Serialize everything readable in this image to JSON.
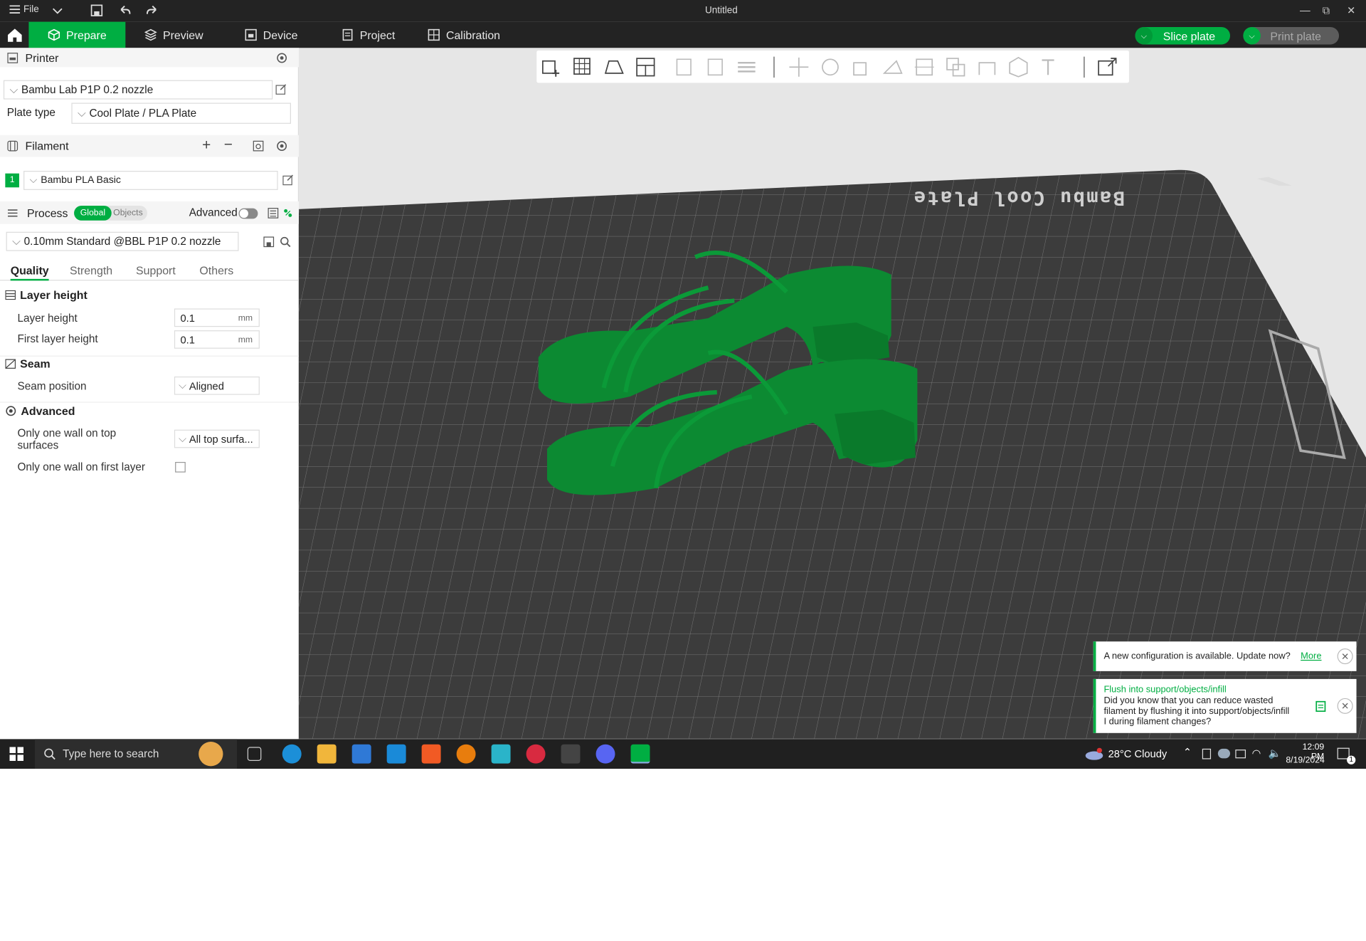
{
  "window": {
    "title": "Untitled",
    "file_menu": "File"
  },
  "tabs": [
    {
      "label": "Prepare"
    },
    {
      "label": "Preview"
    },
    {
      "label": "Device"
    },
    {
      "label": "Project"
    },
    {
      "label": "Calibration"
    }
  ],
  "actions": {
    "slice": "Slice plate",
    "print": "Print plate"
  },
  "printer": {
    "section": "Printer",
    "name": "Bambu Lab P1P 0.2 nozzle",
    "plate_label": "Plate type",
    "plate_value": "Cool Plate / PLA Plate"
  },
  "filament": {
    "section": "Filament",
    "slot": "1",
    "name": "Bambu PLA Basic",
    "slot_color": "#00ae42"
  },
  "process": {
    "section": "Process",
    "toggle_global": "Global",
    "toggle_objects": "Objects",
    "advanced_label": "Advanced",
    "preset": "0.10mm Standard @BBL P1P 0.2 nozzle"
  },
  "quality_tabs": [
    "Quality",
    "Strength",
    "Support",
    "Others"
  ],
  "params": {
    "layer_group": "Layer height",
    "layer_height_label": "Layer height",
    "layer_height_value": "0.1",
    "unit": "mm",
    "first_layer_label": "First layer height",
    "first_layer_value": "0.1",
    "seam_group": "Seam",
    "seam_position_label": "Seam position",
    "seam_position_value": "Aligned",
    "advanced_group": "Advanced",
    "one_wall_top_label_1": "Only one wall on top",
    "one_wall_top_label_2": "surfaces",
    "one_wall_top_value": "All top surfa...",
    "one_wall_first_label": "Only one wall on first layer"
  },
  "plate": {
    "label": "Bambu Cool Plate"
  },
  "notifications": {
    "update_text": "A new configuration is available. Update now?",
    "update_link": "More",
    "tip_title": "Flush into support/objects/infill",
    "tip_line1": "Did you know that you can reduce wasted",
    "tip_line2": "filament by flushing it into support/objects/infill",
    "tip_line3": "I during filament changes?"
  },
  "taskbar": {
    "search_placeholder": "Type here to search",
    "weather": "28°C Cloudy",
    "time": "12:09 PM",
    "date": "8/19/2024",
    "notif_count": "1"
  },
  "colors": {
    "accent": "#00ae42",
    "dark": "#232323",
    "model": "#0c8a32"
  }
}
